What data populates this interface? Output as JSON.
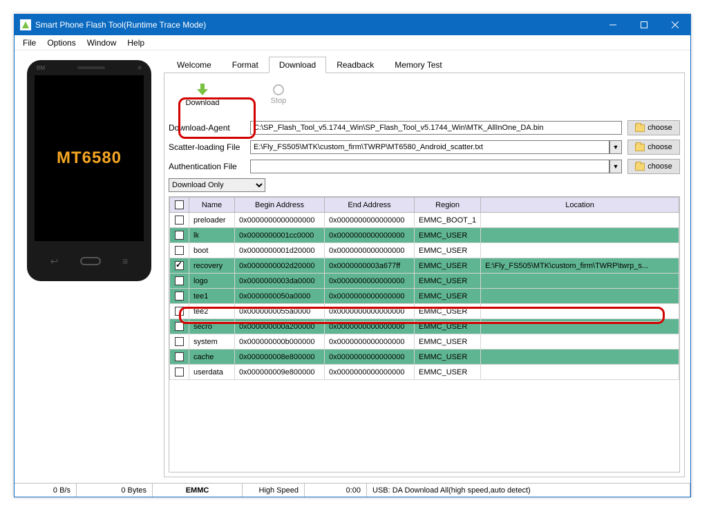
{
  "window": {
    "title": "Smart Phone Flash Tool(Runtime Trace Mode)"
  },
  "menu": {
    "file": "File",
    "options": "Options",
    "window": "Window",
    "help": "Help"
  },
  "phone": {
    "brand": "BM",
    "chip": "MT6580"
  },
  "tabs": {
    "welcome": "Welcome",
    "format": "Format",
    "download": "Download",
    "readback": "Readback",
    "memory": "Memory Test"
  },
  "toolbar": {
    "download": "Download",
    "stop": "Stop"
  },
  "form": {
    "da_label": "Download-Agent",
    "da_value": "C:\\SP_Flash_Tool_v5.1744_Win\\SP_Flash_Tool_v5.1744_Win\\MTK_AllInOne_DA.bin",
    "scatter_label": "Scatter-loading File",
    "scatter_value": "E:\\Fly_FS505\\MTK\\custom_firm\\TWRP\\MT6580_Android_scatter.txt",
    "auth_label": "Authentication File",
    "auth_value": "",
    "choose": "choose",
    "mode": "Download Only"
  },
  "grid": {
    "headers": {
      "name": "Name",
      "begin": "Begin Address",
      "end": "End Address",
      "region": "Region",
      "location": "Location"
    },
    "rows": [
      {
        "chk": false,
        "green": false,
        "name": "preloader",
        "begin": "0x0000000000000000",
        "end": "0x0000000000000000",
        "region": "EMMC_BOOT_1",
        "loc": ""
      },
      {
        "chk": false,
        "green": true,
        "name": "lk",
        "begin": "0x0000000001cc0000",
        "end": "0x0000000000000000",
        "region": "EMMC_USER",
        "loc": ""
      },
      {
        "chk": false,
        "green": false,
        "name": "boot",
        "begin": "0x0000000001d20000",
        "end": "0x0000000000000000",
        "region": "EMMC_USER",
        "loc": ""
      },
      {
        "chk": true,
        "green": true,
        "name": "recovery",
        "begin": "0x0000000002d20000",
        "end": "0x0000000003a677ff",
        "region": "EMMC_USER",
        "loc": "E:\\Fly_FS505\\MTK\\custom_firm\\TWRP\\twrp_s..."
      },
      {
        "chk": false,
        "green": true,
        "name": "logo",
        "begin": "0x0000000003da0000",
        "end": "0x0000000000000000",
        "region": "EMMC_USER",
        "loc": ""
      },
      {
        "chk": false,
        "green": true,
        "name": "tee1",
        "begin": "0x0000000050a0000",
        "end": "0x0000000000000000",
        "region": "EMMC_USER",
        "loc": ""
      },
      {
        "chk": false,
        "green": false,
        "name": "tee2",
        "begin": "0x0000000055a0000",
        "end": "0x0000000000000000",
        "region": "EMMC_USER",
        "loc": ""
      },
      {
        "chk": false,
        "green": true,
        "name": "secro",
        "begin": "0x000000000a200000",
        "end": "0x0000000000000000",
        "region": "EMMC_USER",
        "loc": ""
      },
      {
        "chk": false,
        "green": false,
        "name": "system",
        "begin": "0x000000000b000000",
        "end": "0x0000000000000000",
        "region": "EMMC_USER",
        "loc": ""
      },
      {
        "chk": false,
        "green": true,
        "name": "cache",
        "begin": "0x000000008e800000",
        "end": "0x0000000000000000",
        "region": "EMMC_USER",
        "loc": ""
      },
      {
        "chk": false,
        "green": false,
        "name": "userdata",
        "begin": "0x000000009e800000",
        "end": "0x0000000000000000",
        "region": "EMMC_USER",
        "loc": ""
      }
    ]
  },
  "status": {
    "bps": "0 B/s",
    "bytes": "0 Bytes",
    "emmc": "EMMC",
    "speed": "High Speed",
    "time": "0:00",
    "usb": "USB: DA Download All(high speed,auto detect)"
  }
}
